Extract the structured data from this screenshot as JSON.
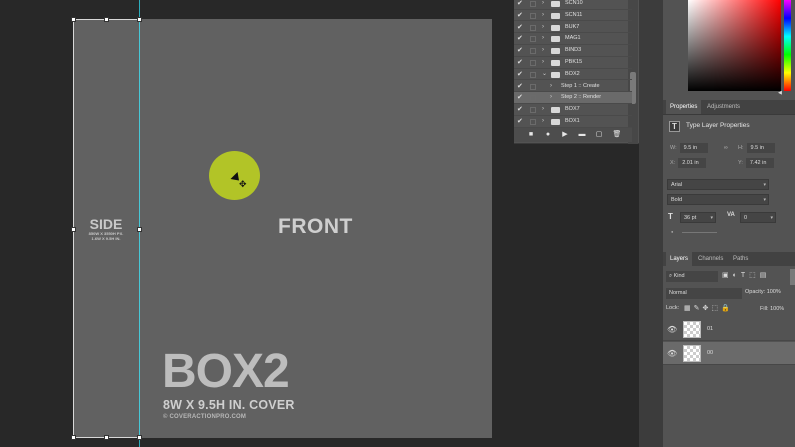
{
  "document": {
    "side_title": "SIDE",
    "side_sub_line1": "850W X 3550H PX.",
    "side_sub_line2": "1.6W X 9.5H IN.",
    "front_label": "FRONT",
    "box_title": "BOX2",
    "box_subtitle": "8W X 9.5H IN. COVER",
    "box_copyright": "© COVERACTIONPRO.COM"
  },
  "actions": {
    "items": [
      {
        "type": "set",
        "label": "SCN10"
      },
      {
        "type": "set",
        "label": "SCN11"
      },
      {
        "type": "set",
        "label": "BUK7"
      },
      {
        "type": "set",
        "label": "MAG1"
      },
      {
        "type": "set",
        "label": "BIND3"
      },
      {
        "type": "set",
        "label": "PBK15"
      },
      {
        "type": "set",
        "label": "BOX2",
        "expanded": true
      },
      {
        "type": "step",
        "label": "Step 1 :: Create"
      },
      {
        "type": "step",
        "label": "Step 2 :: Render",
        "selected": true
      },
      {
        "type": "set",
        "label": "BOX7"
      },
      {
        "type": "set",
        "label": "BOX1"
      }
    ],
    "toolbar_icons": [
      "stop-icon",
      "record-icon",
      "play-icon",
      "new-set-icon",
      "new-action-icon",
      "delete-icon"
    ]
  },
  "properties": {
    "tab_properties": "Properties",
    "tab_adjustments": "Adjustments",
    "title": "Type Layer Properties",
    "w_key": "W:",
    "w_val": "9.5 in",
    "h_key": "H:",
    "h_val": "9.5 in",
    "x_key": "X:",
    "x_val": "2.01 in",
    "y_key": "Y:",
    "y_val": "7.42 in",
    "font_family": "Arial",
    "font_style": "Bold",
    "font_size": "36 pt",
    "tracking": "0"
  },
  "layers": {
    "tab_layers": "Layers",
    "tab_channels": "Channels",
    "tab_paths": "Paths",
    "filter": "Kind",
    "blend_mode": "Normal",
    "opacity_label": "Opacity:",
    "opacity_value": "100%",
    "lock_label": "Lock:",
    "fill_label": "Fill:",
    "fill_value": "100%",
    "rows": [
      {
        "name": "01"
      },
      {
        "name": "00",
        "selected": true
      }
    ]
  },
  "colors": {
    "canvas_bg": "#282828",
    "document_bg": "#616161",
    "panel_bg": "#535353",
    "guide": "#2ec4d6",
    "cursor_highlight": "#b2c427"
  }
}
